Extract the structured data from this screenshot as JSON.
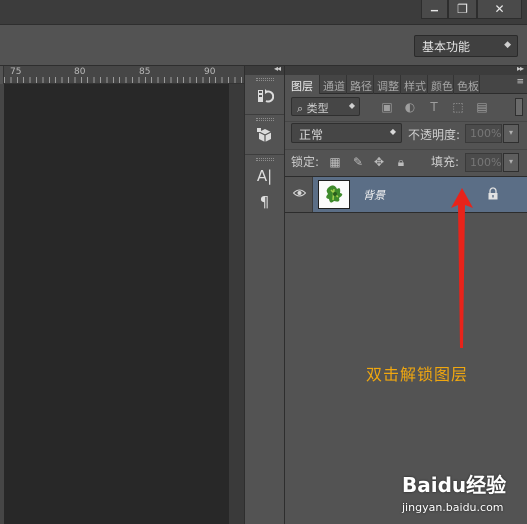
{
  "window": {
    "minimize_glyph": "▁",
    "restore_glyph": "❐",
    "close_glyph": "✕"
  },
  "options_bar": {
    "workspace": "基本功能"
  },
  "ruler": {
    "ticks": [
      "75",
      "80",
      "85",
      "90"
    ]
  },
  "dock": {
    "collapse_glyph": "◂◂",
    "buttons": [
      "history-icon",
      "3d-icon",
      "character-icon",
      "paragraph-icon"
    ],
    "character_glyph": "A|",
    "paragraph_glyph": "¶"
  },
  "layers_panel": {
    "expand_glyph": "▸▸",
    "tabs": [
      "图层",
      "通道",
      "路径",
      "调整",
      "样式",
      "颜色",
      "色板"
    ],
    "active_tab": "图层",
    "filter_kind": "类型",
    "blend_mode": "正常",
    "opacity_label": "不透明度:",
    "opacity_value": "100%",
    "lock_label": "锁定:",
    "fill_label": "填充:",
    "fill_value": "100%",
    "layers": [
      {
        "name": "背景",
        "visible": true,
        "locked": true
      }
    ]
  },
  "annotation": {
    "text": "双击解锁图层",
    "color": "#f0a70f",
    "arrow_color": "#e8231a"
  },
  "watermark": {
    "logo": "Baidu经验",
    "url": "jingyan.baidu.com"
  }
}
